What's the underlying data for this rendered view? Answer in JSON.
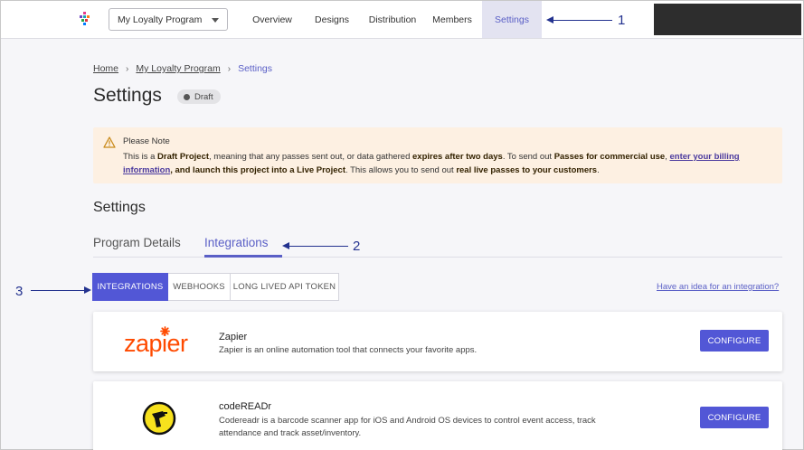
{
  "topbar": {
    "program_select": "My Loyalty Program",
    "nav": [
      {
        "label": "Overview"
      },
      {
        "label": "Designs"
      },
      {
        "label": "Distribution"
      },
      {
        "label": "Members"
      },
      {
        "label": "Settings",
        "active": true
      }
    ]
  },
  "annotations": [
    "1",
    "2",
    "3"
  ],
  "breadcrumb": {
    "home": "Home",
    "program": "My Loyalty Program",
    "current": "Settings"
  },
  "page": {
    "title": "Settings",
    "status": "Draft"
  },
  "note": {
    "title": "Please Note",
    "t1": "This is a ",
    "b1": "Draft Project",
    "t2": ", meaning that any passes sent out, or data gathered ",
    "b2": "expires after two days",
    "t3": ". To send out ",
    "b3": "Passes for commercial use",
    "t4": ", ",
    "link": "enter your billing information",
    "t5": ", and launch this project into a Live Project",
    "t6": ". This allows you to send out ",
    "b4": "real live passes to your customers",
    "t7": "."
  },
  "section_title": "Settings",
  "tabs": {
    "details": "Program Details",
    "integrations": "Integrations"
  },
  "segments": {
    "integrations": "INTEGRATIONS",
    "webhooks": "WEBHOOKS",
    "api_token": "LONG LIVED API TOKEN"
  },
  "idea_link": "Have an idea for an integration?",
  "integrations": [
    {
      "logo_text": "zapier",
      "name": "Zapier",
      "description": "Zapier is an online automation tool that connects your favorite apps.",
      "button": "CONFIGURE"
    },
    {
      "name": "codeREADr",
      "description": "Codereadr is a barcode scanner app for iOS and Android OS devices to control event access, track attendance and track asset/inventory.",
      "button": "CONFIGURE"
    }
  ],
  "colors": {
    "accent": "#5257d6",
    "annotation": "#23328f",
    "zapier": "#ff4a00",
    "note_bg": "#fdf0e2"
  },
  "icons": {
    "logo": "app-logo-icon",
    "dropdown": "chevron-down-icon",
    "warning": "warning-icon",
    "codereadr": "barcode-scanner-icon"
  }
}
